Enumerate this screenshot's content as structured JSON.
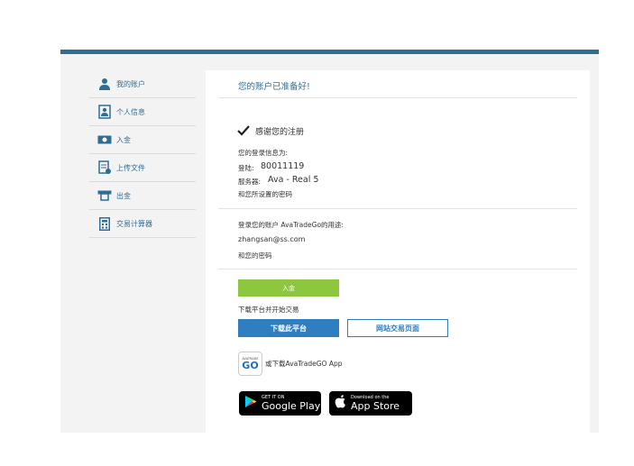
{
  "sidebar": {
    "items": [
      {
        "label": "我的账户",
        "icon": "user-icon"
      },
      {
        "label": "个人信息",
        "icon": "id-card-icon"
      },
      {
        "label": "入金",
        "icon": "cash-icon"
      },
      {
        "label": "上传文件",
        "icon": "upload-document-icon"
      },
      {
        "label": "出金",
        "icon": "withdraw-icon"
      },
      {
        "label": "交易计算器",
        "icon": "calculator-icon"
      }
    ]
  },
  "main": {
    "title": "您的账户已准备好!",
    "thanks": "感谢您的注册",
    "login_info_title": "您的登录信息为:",
    "login_label": "登陆:",
    "login_value": "80011119",
    "server_label": "服务器:",
    "server_value": "Ava - Real 5",
    "password_note": "和您所设置的密码",
    "app_login_title": "登录您的账户 AvaTradeGo的用途:",
    "email": "zhangsan@ss.com",
    "password_note2": "和您的密码",
    "deposit_button": "入金",
    "download_prompt": "下载平台并开始交易",
    "download_button": "下载此平台",
    "webtrader_button": "网站交易页面",
    "app_logo_small": "AVATRADE",
    "app_logo_text": "GO",
    "app_download_text": "或下载AvaTradeGO App",
    "google_play_small": "GET IT ON",
    "google_play_big": "Google Play",
    "app_store_small": "Download on the",
    "app_store_big": "App Store"
  },
  "colors": {
    "accent": "#2f6e93",
    "green": "#8dc63f",
    "blue": "#2f7fc0"
  }
}
